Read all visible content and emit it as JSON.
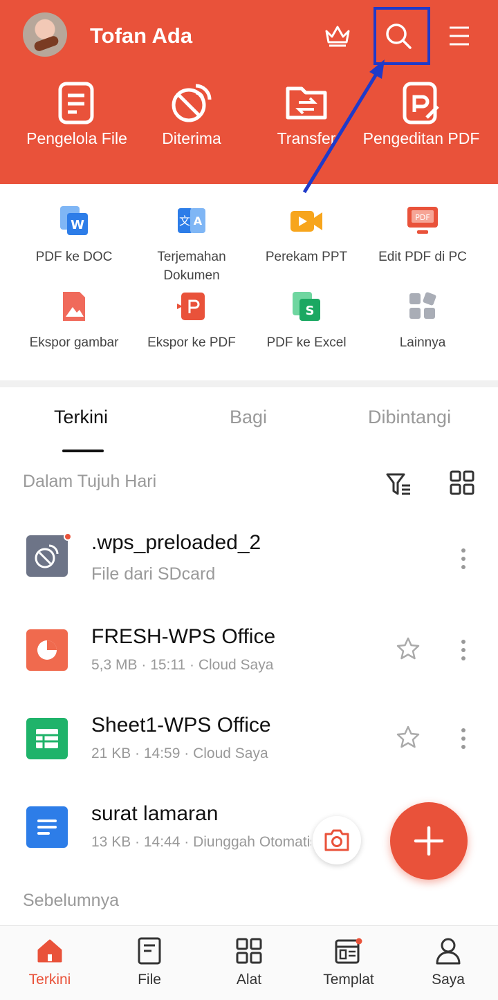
{
  "header": {
    "user_name": "Tofan Ada",
    "accent_color": "#e9523a",
    "icons": [
      "crown-icon",
      "search-icon",
      "menu-icon"
    ]
  },
  "quick_actions": [
    {
      "label": "Pengelola File",
      "icon": "file-manager-icon"
    },
    {
      "label": "Diterima",
      "icon": "received-icon"
    },
    {
      "label": "Transfer",
      "icon": "transfer-icon"
    },
    {
      "label": "Pengeditan PDF",
      "icon": "pdf-edit-icon"
    }
  ],
  "tools": [
    {
      "label": "PDF ke DOC",
      "icon": "pdf-to-doc-icon"
    },
    {
      "label": "Terjemahan Dokumen",
      "icon": "translate-icon"
    },
    {
      "label": "Perekam PPT",
      "icon": "ppt-recorder-icon"
    },
    {
      "label": "Edit PDF di PC",
      "icon": "pdf-pc-icon"
    },
    {
      "label": "Ekspor gambar",
      "icon": "export-image-icon"
    },
    {
      "label": "Ekspor ke PDF",
      "icon": "export-pdf-icon"
    },
    {
      "label": "PDF ke Excel",
      "icon": "pdf-to-excel-icon"
    },
    {
      "label": "Lainnya",
      "icon": "more-apps-icon"
    }
  ],
  "tabs": [
    {
      "label": "Terkini",
      "active": true
    },
    {
      "label": "Bagi",
      "active": false
    },
    {
      "label": "Dibintangi",
      "active": false
    }
  ],
  "sections": {
    "recent": "Dalam Tujuh Hari",
    "earlier": "Sebelumnya"
  },
  "files": [
    {
      "name": ".wps_preloaded_2",
      "meta": "File dari SDcard",
      "icon": "received-folder-icon",
      "starrable": false
    },
    {
      "name": "FRESH-WPS Office",
      "meta": "5,3 MB · 15:11 · Cloud Saya",
      "icon": "presentation-icon",
      "starrable": true
    },
    {
      "name": "Sheet1-WPS Office",
      "meta": "21 KB · 14:59 · Cloud Saya",
      "icon": "spreadsheet-icon",
      "starrable": true
    },
    {
      "name": "surat lamaran",
      "meta": "13 KB · 14:44 · Diunggah Otomatis",
      "icon": "document-icon",
      "starrable": false
    }
  ],
  "bottom_nav": [
    {
      "label": "Terkini",
      "icon": "home-icon",
      "active": true
    },
    {
      "label": "File",
      "icon": "file-icon",
      "active": false
    },
    {
      "label": "Alat",
      "icon": "tools-grid-icon",
      "active": false
    },
    {
      "label": "Templat",
      "icon": "template-icon",
      "active": false
    },
    {
      "label": "Saya",
      "icon": "profile-icon",
      "active": false
    }
  ]
}
